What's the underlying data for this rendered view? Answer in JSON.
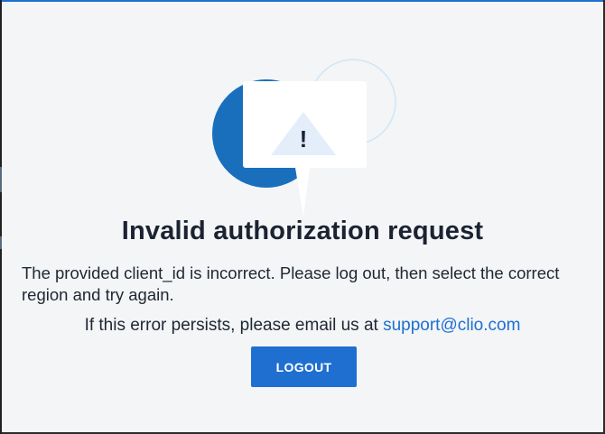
{
  "colors": {
    "accent": "#1f6fd0",
    "background": "#f3f5f7",
    "text": "#1b2332",
    "circle_dark": "#1a6fbd",
    "circle_light_outline": "#cfe6f7",
    "warning_triangle": "#e3eefa"
  },
  "illustration": {
    "icon": "warning-triangle-icon",
    "symbol": "!"
  },
  "error": {
    "title": "Invalid authorization request",
    "message": "The provided client_id is incorrect. Please log out, then select the correct region and try again.",
    "support_prefix": "If this error persists, please email us at ",
    "support_email": "support@clio.com"
  },
  "actions": {
    "logout_label": "LOGOUT"
  }
}
